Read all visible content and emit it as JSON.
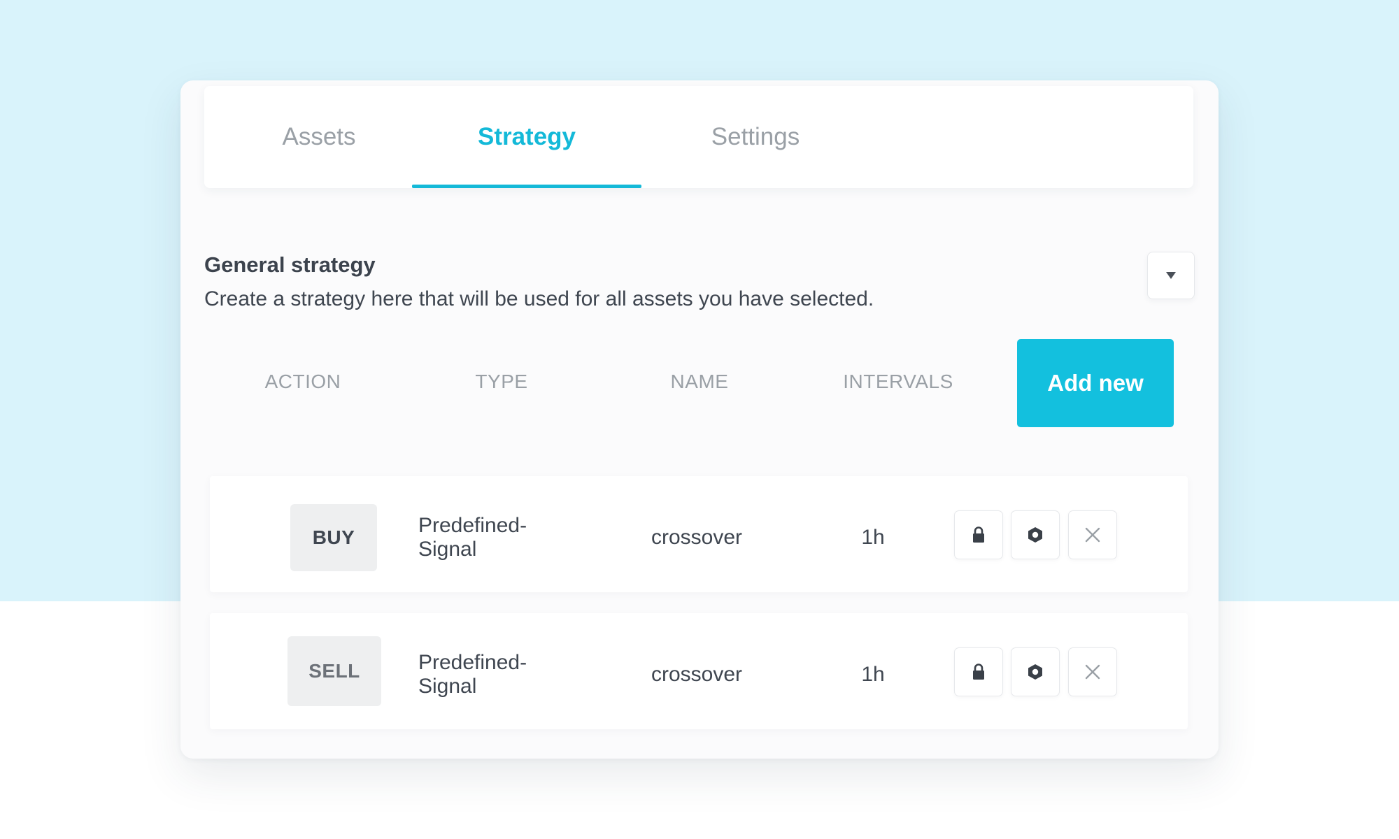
{
  "tabs": [
    {
      "label": "Assets",
      "active": false
    },
    {
      "label": "Strategy",
      "active": true
    },
    {
      "label": "Settings",
      "active": false
    }
  ],
  "section": {
    "title": "General strategy",
    "description": "Create a strategy here that will be used for all assets you have selected.",
    "collapse_icon": "caret-down-icon"
  },
  "table": {
    "columns": [
      "ACTION",
      "TYPE",
      "NAME",
      "INTERVALS"
    ],
    "add_button": "Add new",
    "rows": [
      {
        "action": "BUY",
        "type": "Predefined-Signal",
        "name": "crossover",
        "interval": "1h"
      },
      {
        "action": "SELL",
        "type": "Predefined-Signal",
        "name": "crossover",
        "interval": "1h"
      }
    ],
    "row_icons": [
      "lock-icon",
      "settings-icon",
      "close-icon"
    ]
  },
  "colors": {
    "accent": "#13c0de",
    "background_top": "#d9f3fb",
    "text_primary": "#3f4650",
    "text_muted": "#9aa0a6"
  }
}
